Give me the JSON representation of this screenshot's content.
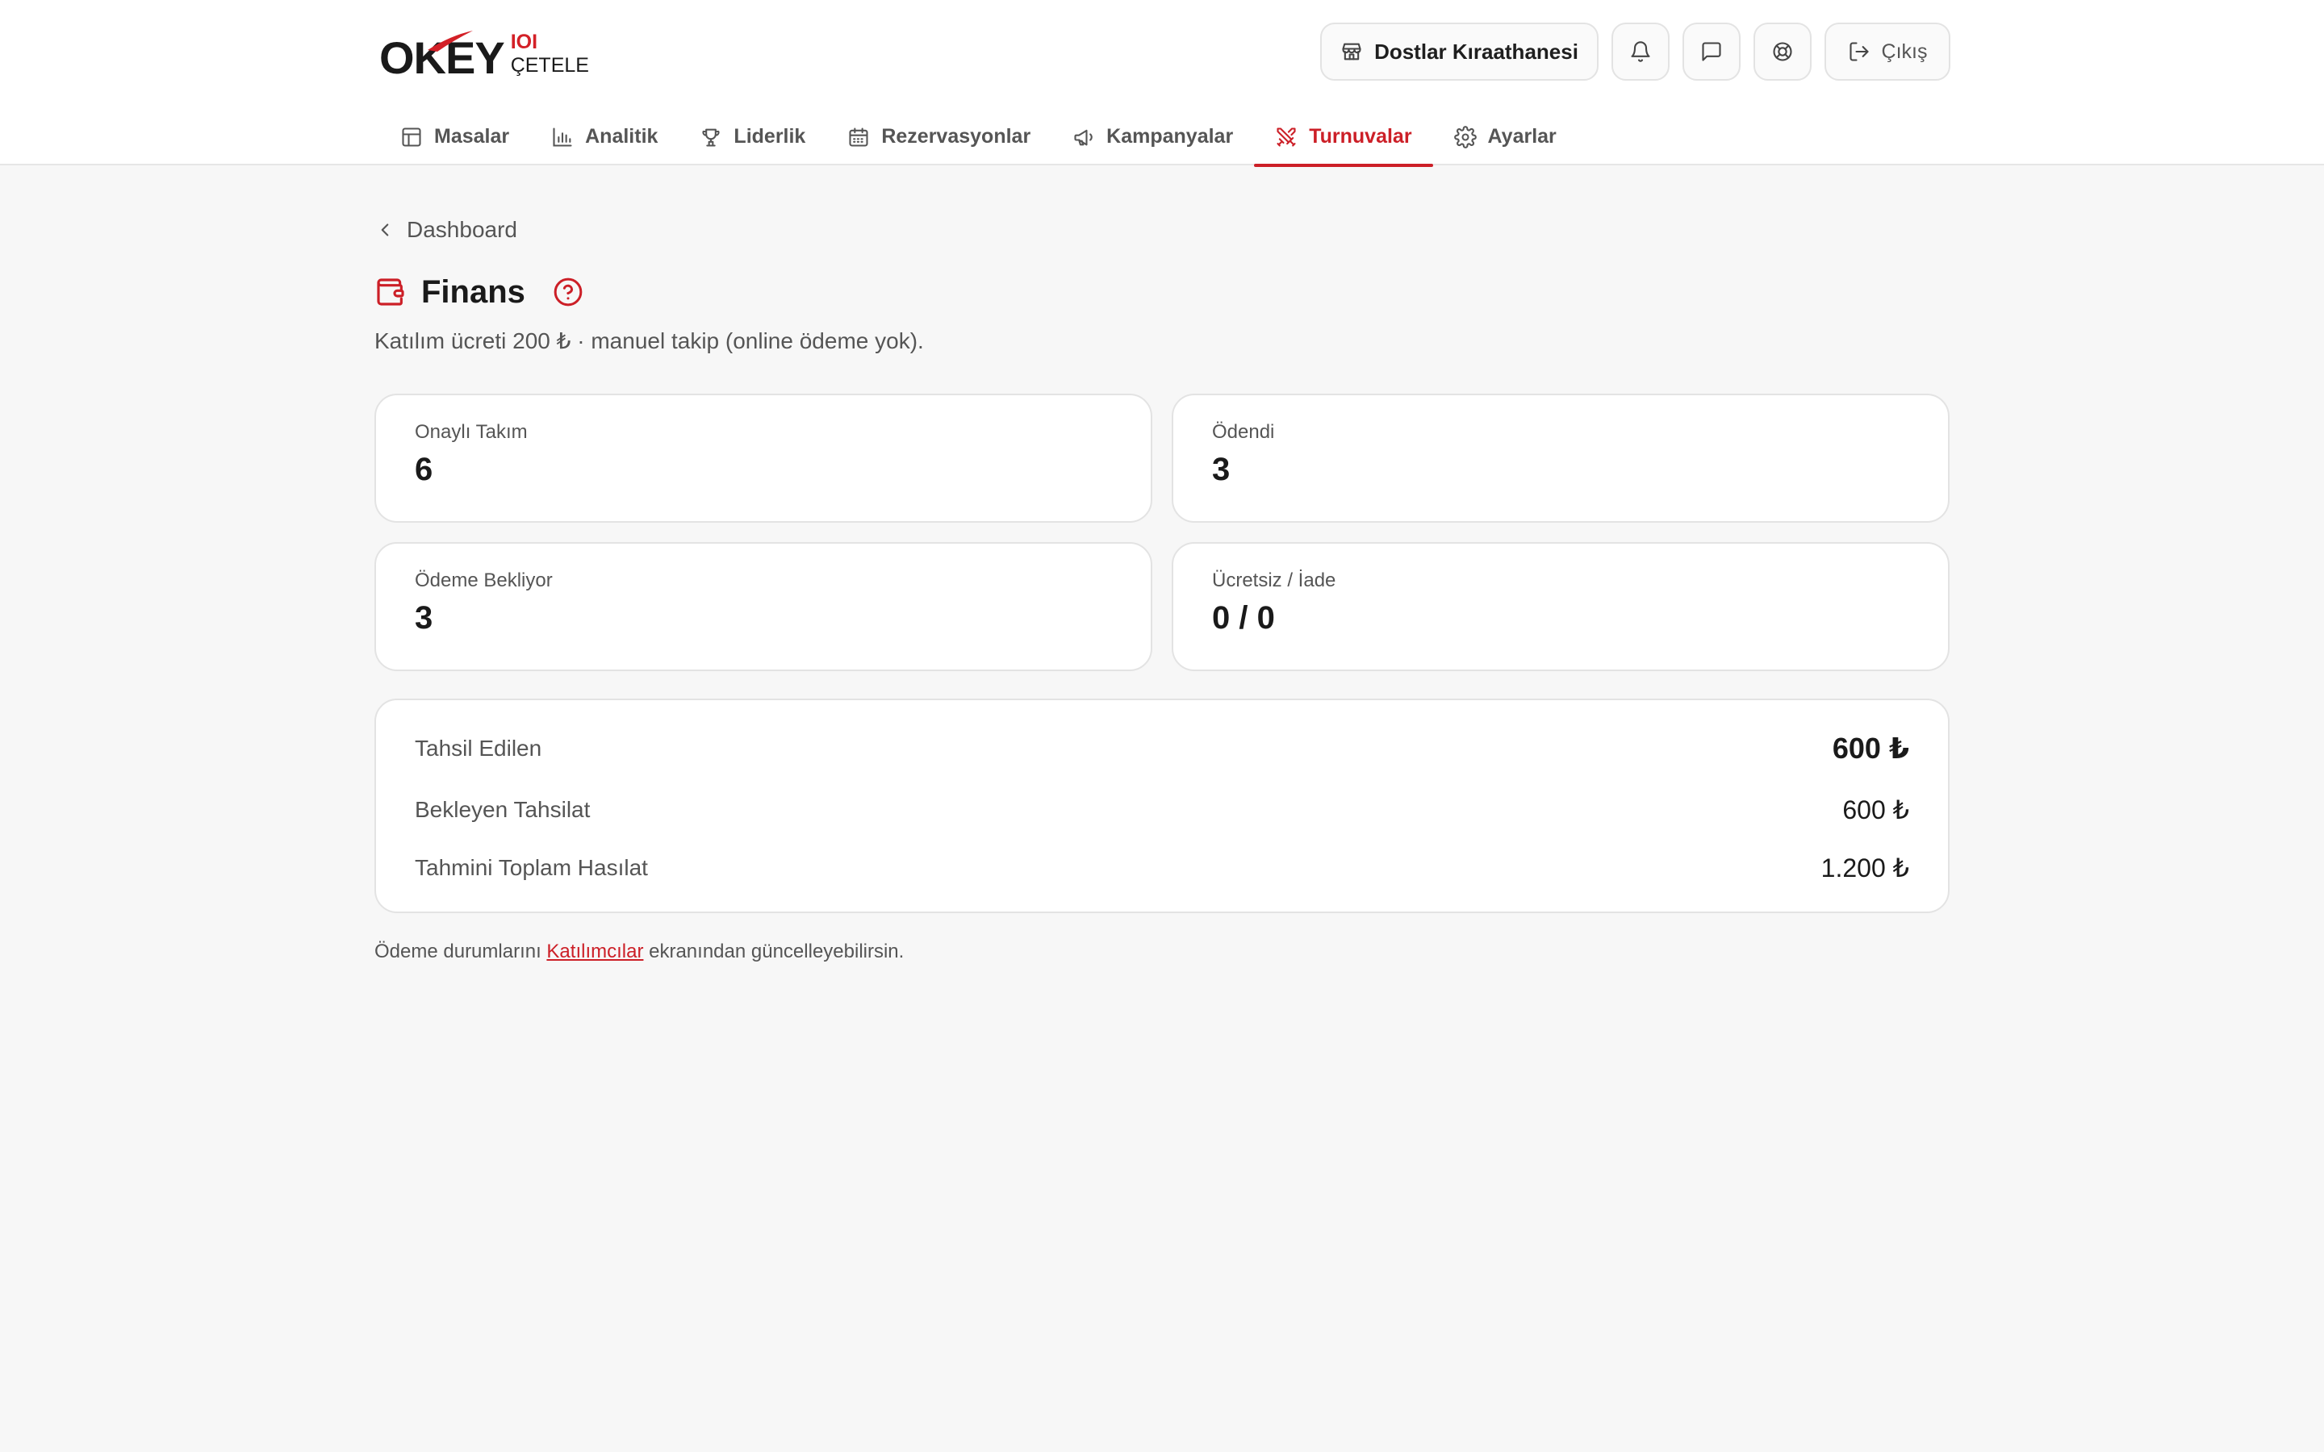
{
  "brand": {
    "logo_main": "OKEY",
    "logo_tiles": "IOI",
    "logo_sub": "ÇETELE"
  },
  "header": {
    "venue_label": "Dostlar Kıraathanesi",
    "logout_label": "Çıkış"
  },
  "nav": {
    "items": [
      {
        "label": "Masalar",
        "icon": "table-icon"
      },
      {
        "label": "Analitik",
        "icon": "bar-chart-icon"
      },
      {
        "label": "Liderlik",
        "icon": "trophy-icon"
      },
      {
        "label": "Rezervasyonlar",
        "icon": "calendar-icon"
      },
      {
        "label": "Kampanyalar",
        "icon": "megaphone-icon"
      },
      {
        "label": "Turnuvalar",
        "icon": "swords-icon",
        "active": true
      },
      {
        "label": "Ayarlar",
        "icon": "gear-icon"
      }
    ]
  },
  "page": {
    "back_label": "Dashboard",
    "title": "Finans",
    "subtitle": "Katılım ücreti 200 ₺ · manuel takip (online ödeme yok)."
  },
  "stats": [
    {
      "label": "Onaylı Takım",
      "value": "6"
    },
    {
      "label": "Ödendi",
      "value": "3"
    },
    {
      "label": "Ödeme Bekliyor",
      "value": "3"
    },
    {
      "label": "Ücretsiz / İade",
      "value": "0 / 0"
    }
  ],
  "summary": {
    "collected_label": "Tahsil Edilen",
    "collected_value": "600 ₺",
    "pending_label": "Bekleyen Tahsilat",
    "pending_value": "600 ₺",
    "total_label": "Tahmini Toplam Hasılat",
    "total_value": "1.200 ₺"
  },
  "footnote": {
    "before": "Ödeme durumlarını ",
    "link": "Katılımcılar",
    "after": " ekranından güncelleyebilirsin."
  },
  "colors": {
    "accent": "#cc1f27",
    "background": "#f7f7f7",
    "card": "#ffffff",
    "border": "#e3e3e3"
  }
}
